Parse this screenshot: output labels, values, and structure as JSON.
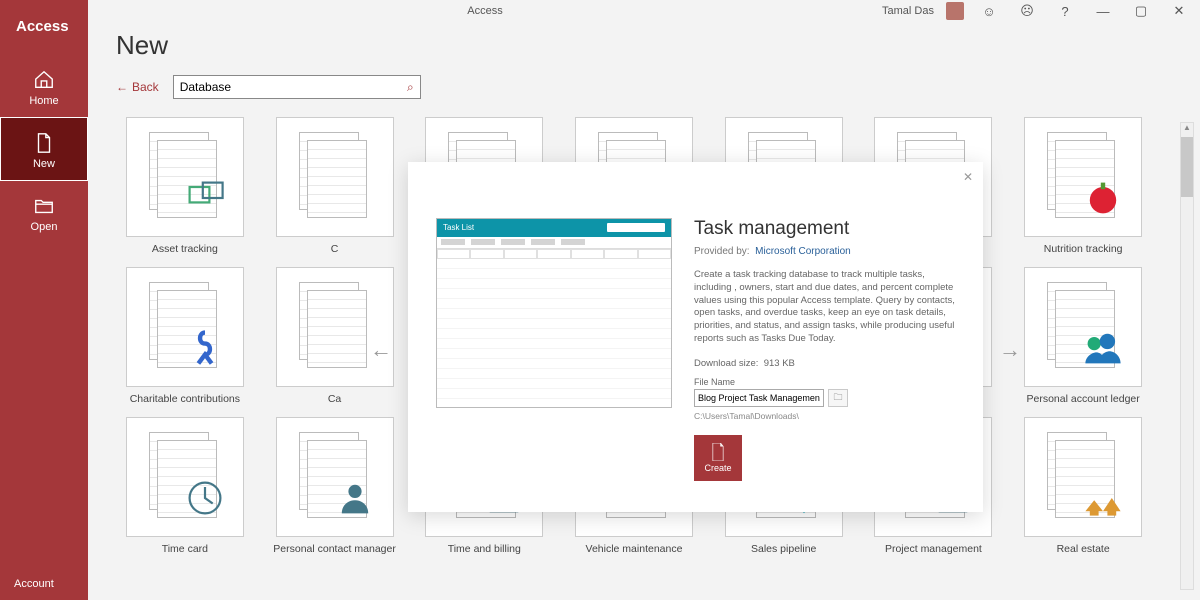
{
  "app": {
    "title": "Access",
    "center_title": "Access"
  },
  "user": {
    "name": "Tamal Das"
  },
  "sidebar": {
    "brand": "Access",
    "items": [
      {
        "label": "Home"
      },
      {
        "label": "New"
      },
      {
        "label": "Open"
      }
    ],
    "account": "Account"
  },
  "page": {
    "title": "New",
    "back": "Back"
  },
  "search": {
    "value": "Database"
  },
  "templates": [
    {
      "label": "Asset tracking"
    },
    {
      "label": "C"
    },
    {
      "label": ""
    },
    {
      "label": ""
    },
    {
      "label": ""
    },
    {
      "label": ""
    },
    {
      "label": "Nutrition tracking"
    },
    {
      "label": "Charitable contributions"
    },
    {
      "label": "Ca"
    },
    {
      "label": ""
    },
    {
      "label": ""
    },
    {
      "label": ""
    },
    {
      "label": ""
    },
    {
      "label": "Personal account ledger"
    },
    {
      "label": "Time card"
    },
    {
      "label": "Personal contact manager"
    },
    {
      "label": "Time and billing"
    },
    {
      "label": "Vehicle maintenance"
    },
    {
      "label": "Sales pipeline"
    },
    {
      "label": "Project management"
    },
    {
      "label": "Real estate"
    }
  ],
  "modal": {
    "preview_title": "Task List",
    "title": "Task management",
    "provided_label": "Provided by:",
    "provided_link": "Microsoft Corporation",
    "description": "Create a task tracking database to track multiple tasks, including , owners, start and due dates, and percent complete values using this popular Access template. Query by contacts, open tasks, and overdue tasks, keep an eye on task details, priorities, and status, and assign tasks, while producing useful reports such as Tasks Due Today.",
    "download_label": "Download size:",
    "download_size": "913 KB",
    "filename_label": "File Name",
    "filename_value": "Blog Project Task Management.ac",
    "path": "C:\\Users\\Tamal\\Downloads\\",
    "create": "Create"
  }
}
